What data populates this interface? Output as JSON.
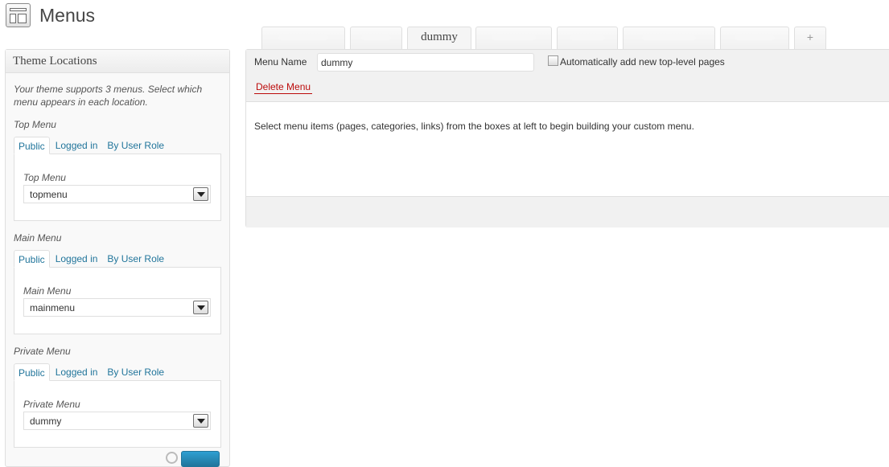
{
  "header": {
    "title": "Menus",
    "icon": "menus-icon"
  },
  "sidebar": {
    "title": "Theme Locations",
    "intro": "Your theme supports 3 menus. Select which menu appears in each location.",
    "locations": [
      {
        "title": "Top Menu",
        "tabs": [
          "Public",
          "Logged in",
          "By User Role"
        ],
        "panel_label": "Top Menu",
        "selected": "topmenu"
      },
      {
        "title": "Main Menu",
        "tabs": [
          "Public",
          "Logged in",
          "By User Role"
        ],
        "panel_label": "Main Menu",
        "selected": "mainmenu"
      },
      {
        "title": "Private Menu",
        "tabs": [
          "Public",
          "Logged in",
          "By User Role"
        ],
        "panel_label": "Private Menu",
        "selected": "dummy"
      }
    ]
  },
  "menu_tabs": {
    "active": "dummy",
    "add": "+"
  },
  "editor": {
    "name_label": "Menu Name",
    "name_value": "dummy",
    "auto_add_label": "Automatically add new top-level pages",
    "auto_add_checked": false,
    "delete_label": "Delete Menu",
    "instructions": "Select menu items (pages, categories, links) from the boxes at left to begin building your custom menu."
  },
  "colors": {
    "link": "#21759b",
    "delete": "#bc0b0b",
    "panel_bg": "#f1f1f1",
    "border": "#dfdfdf"
  }
}
